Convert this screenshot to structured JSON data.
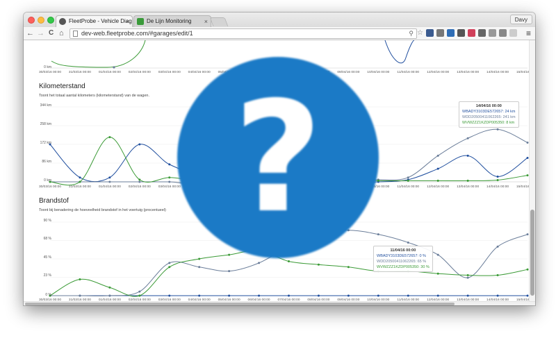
{
  "browser": {
    "profile": "Davy",
    "tabs": [
      {
        "title": "FleetProbe - Vehicle Diagn",
        "close": "×"
      },
      {
        "title": "De Lijn Monitoring",
        "close": "×"
      }
    ],
    "url": "dev-web.fleetprobe.com/#garages/edit/1",
    "nav": {
      "back": "←",
      "forward": "→",
      "reload": "C",
      "home": "⌂"
    }
  },
  "x_labels": [
    "30/03/16 00:00",
    "31/03/16 00:00",
    "01/04/16 00:00",
    "02/04/16 00:00",
    "03/04/16 00:00",
    "04/04/16 00:00",
    "05/04/16 00:00",
    "06/04/16 00:00",
    "07/04/16 00:00",
    "08/04/16 00:00",
    "09/04/16 00:00",
    "10/04/16 00:00",
    "11/04/16 00:00",
    "12/04/16 00:00",
    "13/04/16 00:00",
    "14/04/16 00:00",
    "15/04/16 00:00"
  ],
  "top_chart": {
    "y_label_bottom": "0 km"
  },
  "kilometer": {
    "title": "Kilometerstand",
    "description": "Toont het totaal aantal kilometers (kilometerstand) van de wagen.",
    "y_ticks": [
      "344 km",
      "258 km",
      "172 km",
      "86 km",
      "0 km"
    ],
    "tooltip": {
      "header": "14/04/16 00:00",
      "lines": [
        "WBADY3103DE572657: 24 km",
        "WDD20500411062265: 241 km",
        "WVWZZZ1KZDP005350: 8 km"
      ]
    }
  },
  "brandstof": {
    "title": "Brandstof",
    "description": "Toont bij benadering de hoeveelheid brandstof in het voertuig (procentueel)",
    "y_ticks": [
      "90 %",
      "68 %",
      "45 %",
      "23 %",
      "0 %"
    ],
    "tooltip": {
      "header": "11/04/16 00:00",
      "lines": [
        "WBADY3103DE572657: 0 %",
        "WDD20500411062265: 65 %",
        "WVWZZZ1KZDP005350: 30 %"
      ]
    }
  },
  "chart_data": [
    {
      "type": "line",
      "title": "Kilometerstand",
      "x": [
        "30/03/16 00:00",
        "31/03/16 00:00",
        "01/04/16 00:00",
        "02/04/16 00:00",
        "03/04/16 00:00",
        "04/04/16 00:00",
        "05/04/16 00:00",
        "06/04/16 00:00",
        "07/04/16 00:00",
        "08/04/16 00:00",
        "09/04/16 00:00",
        "10/04/16 00:00",
        "11/04/16 00:00",
        "12/04/16 00:00",
        "13/04/16 00:00",
        "14/04/16 00:00",
        "15/04/16 00:00"
      ],
      "ylim": [
        0,
        344
      ],
      "series": [
        {
          "name": "WBADY3103DE572657",
          "color": "#1f4e9e",
          "values": [
            172,
            20,
            20,
            172,
            80,
            40,
            80,
            150,
            60,
            100,
            0,
            0,
            10,
            60,
            120,
            24,
            110
          ]
        },
        {
          "name": "WDD20500411062265",
          "color": "#6a7d99",
          "values": [
            0,
            0,
            0,
            0,
            0,
            0,
            120,
            180,
            120,
            60,
            20,
            10,
            20,
            120,
            200,
            241,
            180
          ]
        },
        {
          "name": "WVWZZZ1KZDP005350",
          "color": "#3a9a35",
          "values": [
            0,
            0,
            205,
            10,
            20,
            10,
            60,
            10,
            90,
            60,
            10,
            5,
            5,
            5,
            5,
            8,
            30
          ]
        }
      ]
    },
    {
      "type": "line",
      "title": "Brandstof",
      "x": [
        "30/03/16 00:00",
        "31/03/16 00:00",
        "01/04/16 00:00",
        "02/04/16 00:00",
        "03/04/16 00:00",
        "04/04/16 00:00",
        "05/04/16 00:00",
        "06/04/16 00:00",
        "07/04/16 00:00",
        "08/04/16 00:00",
        "09/04/16 00:00",
        "10/04/16 00:00",
        "11/04/16 00:00",
        "12/04/16 00:00",
        "13/04/16 00:00",
        "14/04/16 00:00",
        "15/04/16 00:00"
      ],
      "ylim": [
        0,
        90
      ],
      "series": [
        {
          "name": "WBADY3103DE572657",
          "color": "#1f4e9e",
          "values": [
            0,
            0,
            0,
            0,
            0,
            0,
            0,
            0,
            0,
            0,
            0,
            0,
            0,
            0,
            0,
            0,
            0
          ]
        },
        {
          "name": "WDD20500411062265",
          "color": "#6a7d99",
          "values": [
            0,
            0,
            0,
            5,
            40,
            35,
            30,
            40,
            60,
            75,
            80,
            75,
            65,
            50,
            22,
            60,
            75
          ]
        },
        {
          "name": "WVWZZZ1KZDP005350",
          "color": "#3a9a35",
          "values": [
            0,
            20,
            10,
            0,
            35,
            45,
            50,
            55,
            42,
            38,
            35,
            30,
            30,
            27,
            25,
            25,
            32
          ]
        }
      ]
    }
  ]
}
